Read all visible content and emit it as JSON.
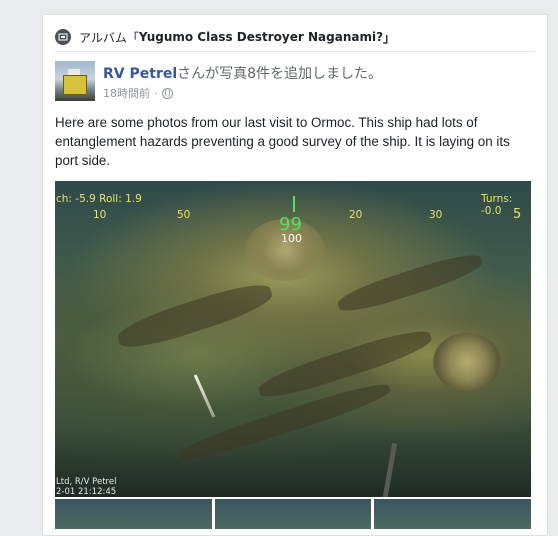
{
  "album": {
    "prefix": "アルバム「",
    "title": "Yugumo Class Destroyer Naganami?",
    "suffix": "」"
  },
  "post": {
    "author": "RV Petrel",
    "action": "さんが写真8件を追加しました。",
    "time": "18時間前",
    "dot": "·",
    "body": "Here are some photos from our last visit to Ormoc. This ship had lots of entanglement hazards preventing a good survey of the ship. It is laying on its port side."
  },
  "photo": {
    "overlay_left": "ch: -5.9    Roll: 1.9",
    "overlay_right": "Turns: -0.0",
    "compass_ticks": [
      "10",
      "50",
      "20",
      "30",
      "5"
    ],
    "heading": "99",
    "heading_ref": "100",
    "footer_line1": "Ltd, R/V Petrel",
    "footer_line2": "2-01 21:12:45"
  },
  "icons": {
    "album": "album-icon",
    "privacy": "globe-icon"
  },
  "colors": {
    "link": "#365899",
    "muted": "#90949c",
    "osd_yellow": "#e6e26a",
    "osd_green": "#52e06a"
  }
}
